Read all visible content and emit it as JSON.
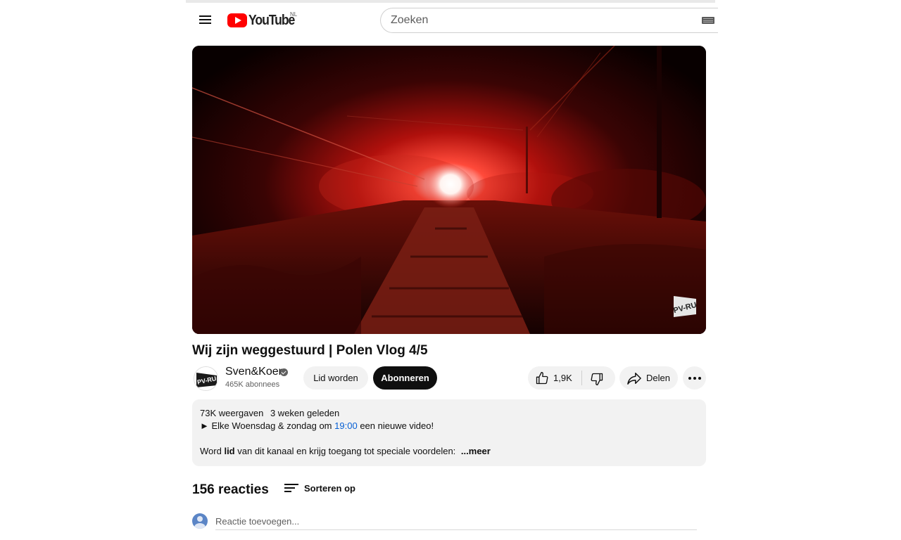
{
  "header": {
    "logo_text": "YouTube",
    "region": "NL",
    "search_placeholder": "Zoeken"
  },
  "video": {
    "title": "Wij zijn weggestuurd | Polen Vlog 4/5"
  },
  "channel": {
    "name": "Sven&Koen",
    "subscribers": "465K abonnees",
    "join_label": "Lid worden",
    "subscribe_label": "Abonneren"
  },
  "actions": {
    "like_count": "1,9K",
    "share_label": "Delen"
  },
  "description": {
    "views": "73K weergaven",
    "date": "3 weken geleden",
    "line1_prefix": "►  Elke Woensdag & zondag om",
    "line1_time": "19:00",
    "line1_suffix": "een nieuwe video!",
    "line2_prefix": "Word",
    "line2_bold": "lid",
    "line2_suffix": "van dit kanaal en krijg toegang tot speciale voordelen:",
    "more_label": "...meer"
  },
  "comments": {
    "count_label": "156 reacties",
    "sort_label": "Sorteren op",
    "add_placeholder": "Reactie toevoegen..."
  },
  "colors": {
    "brand_red": "#ff0000",
    "link_blue": "#065fd4",
    "subscribe_bg": "#0f0f0f"
  }
}
